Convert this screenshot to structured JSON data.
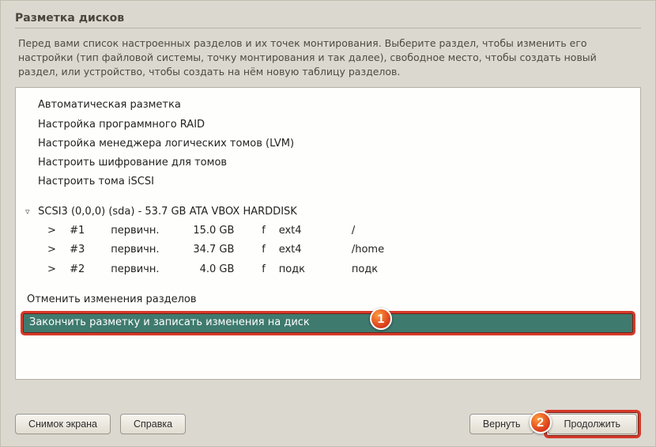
{
  "title": "Разметка дисков",
  "description": "Перед вами список настроенных разделов и их точек монтирования. Выберите раздел, чтобы изменить его настройки (тип файловой системы, точку монтирования и так далее), свободное место, чтобы создать новый раздел, или устройство, чтобы создать на нём новую таблицу разделов.",
  "options": {
    "guided": "Автоматическая разметка",
    "raid": "Настройка программного RAID",
    "lvm": "Настройка менеджера логических томов (LVM)",
    "crypt": "Настроить шифрование для томов",
    "iscsi": "Настроить тома iSCSI"
  },
  "disk": {
    "label": "SCSI3 (0,0,0) (sda) - 53.7 GB ATA VBOX HARDDISK"
  },
  "partitions": [
    {
      "arrow": ">",
      "num": "#1",
      "type": "первичн.",
      "size": "15.0 GB",
      "flag": "f",
      "fs": "ext4",
      "mount": "/"
    },
    {
      "arrow": ">",
      "num": "#3",
      "type": "первичн.",
      "size": "34.7 GB",
      "flag": "f",
      "fs": "ext4",
      "mount": "/home"
    },
    {
      "arrow": ">",
      "num": "#2",
      "type": "первичн.",
      "size": "4.0 GB",
      "flag": "f",
      "fs": "подк",
      "mount": "подк"
    }
  ],
  "undo": "Отменить изменения разделов",
  "finish": "Закончить разметку и записать изменения на диск",
  "buttons": {
    "screenshot": "Снимок экрана",
    "help": "Справка",
    "back": "Вернуть",
    "continue": "Продолжить"
  },
  "badges": {
    "one": "1",
    "two": "2"
  }
}
